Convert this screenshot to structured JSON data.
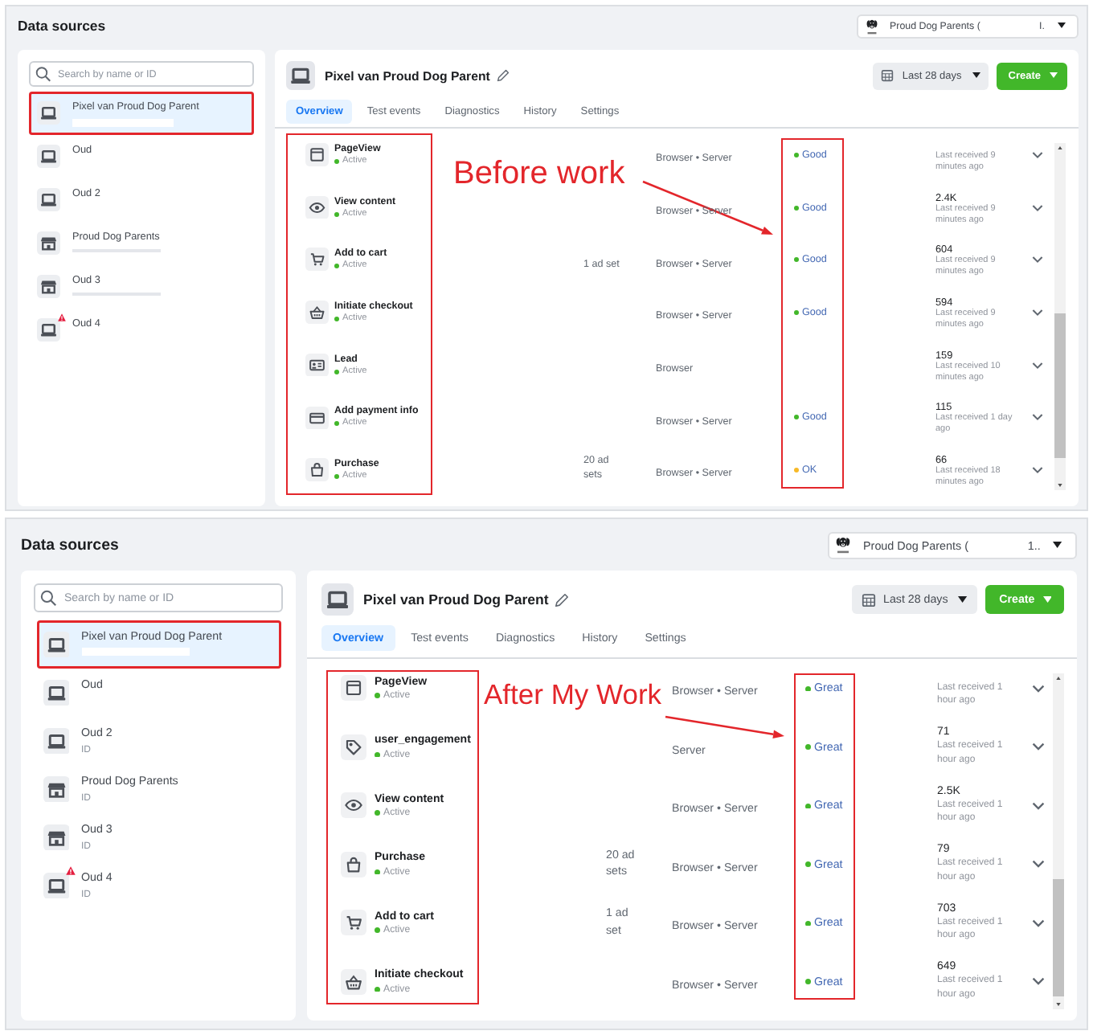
{
  "screens": [
    {
      "title": "Data sources",
      "account": {
        "name": "Proud Dog Parents (",
        "suffix": "I."
      },
      "search": {
        "placeholder": "Search by name or ID"
      },
      "sources": [
        {
          "kind": "pixel",
          "name": "Pixel van Proud Dog Parent",
          "selected": true,
          "outlined": true,
          "redacted": true,
          "warning": false
        },
        {
          "kind": "pixel",
          "name": "Oud",
          "selected": false,
          "outlined": false,
          "redacted": false,
          "warning": false
        },
        {
          "kind": "pixel",
          "name": "Oud 2",
          "selected": false,
          "outlined": false,
          "redacted": false,
          "warning": false
        },
        {
          "kind": "store",
          "name": "Proud Dog Parents",
          "selected": false,
          "outlined": false,
          "redacted": true,
          "warning": false
        },
        {
          "kind": "store",
          "name": "Oud 3",
          "selected": false,
          "outlined": false,
          "redacted": true,
          "warning": false
        },
        {
          "kind": "pixel",
          "name": "Oud 4",
          "selected": false,
          "outlined": false,
          "redacted": false,
          "warning": true
        }
      ],
      "pixel": {
        "title": "Pixel van Proud Dog Parent",
        "date_range": "Last 28 days",
        "create": "Create"
      },
      "tabs": [
        {
          "label": "Overview",
          "selected": true
        },
        {
          "label": "Test events",
          "selected": false
        },
        {
          "label": "Diagnostics",
          "selected": false
        },
        {
          "label": "History",
          "selected": false
        },
        {
          "label": "Settings",
          "selected": false
        }
      ],
      "events": [
        {
          "kind": "pageview",
          "name": "PageView",
          "status": "Active",
          "integration": "Browser • Server",
          "quality": {
            "text": "Good",
            "color": "#42b72a"
          },
          "last_received": "Last received 9 minutes ago"
        },
        {
          "kind": "view",
          "name": "View content",
          "status": "Active",
          "integration": "Browser • Server",
          "quality": {
            "text": "Good",
            "color": "#42b72a"
          },
          "count": "2.4K",
          "last_received": "Last received 9 minutes ago"
        },
        {
          "kind": "cart",
          "name": "Add to cart",
          "status": "Active",
          "ad_sets": "1 ad set",
          "integration": "Browser • Server",
          "quality": {
            "text": "Good",
            "color": "#42b72a"
          },
          "count": "604",
          "last_received": "Last received 9 minutes ago"
        },
        {
          "kind": "checkout",
          "name": "Initiate checkout",
          "status": "Active",
          "integration": "Browser • Server",
          "quality": {
            "text": "Good",
            "color": "#42b72a"
          },
          "count": "594",
          "last_received": "Last received 9 minutes ago"
        },
        {
          "kind": "lead",
          "name": "Lead",
          "status": "Active",
          "integration": "Browser",
          "count": "159",
          "last_received": "Last received 10 minutes ago"
        },
        {
          "kind": "payment",
          "name": "Add payment info",
          "status": "Active",
          "integration": "Browser • Server",
          "quality": {
            "text": "Good",
            "color": "#42b72a"
          },
          "count": "115",
          "last_received": "Last received 1 day ago"
        },
        {
          "kind": "purchase",
          "name": "Purchase",
          "status": "Active",
          "ad_sets": "20 ad sets",
          "integration": "Browser • Server",
          "quality": {
            "text": "OK",
            "color": "#f7b928"
          },
          "count": "66",
          "last_received": "Last received 18 minutes ago"
        }
      ],
      "annotation": {
        "note": "Before work"
      }
    },
    {
      "title": "Data sources",
      "account": {
        "name": "Proud Dog Parents (",
        "suffix": "1.."
      },
      "search": {
        "placeholder": "Search by name or ID"
      },
      "sources": [
        {
          "kind": "pixel",
          "name": "Pixel van Proud Dog Parent",
          "selected": true,
          "outlined": true,
          "redacted": true,
          "warning": false
        },
        {
          "kind": "pixel",
          "name": "Oud",
          "selected": false,
          "outlined": false,
          "redacted": false,
          "warning": false
        },
        {
          "kind": "pixel",
          "name": "Oud 2",
          "subtitle": "ID",
          "selected": false,
          "outlined": false,
          "redacted": false,
          "warning": false
        },
        {
          "kind": "store",
          "name": "Proud Dog Parents",
          "subtitle": "ID",
          "selected": false,
          "outlined": false,
          "redacted": false,
          "warning": false
        },
        {
          "kind": "store",
          "name": "Oud 3",
          "subtitle": "ID",
          "selected": false,
          "outlined": false,
          "redacted": false,
          "warning": false
        },
        {
          "kind": "pixel",
          "name": "Oud 4",
          "subtitle": "ID",
          "selected": false,
          "outlined": false,
          "redacted": false,
          "warning": true
        }
      ],
      "pixel": {
        "title": "Pixel van Proud Dog Parent",
        "date_range": "Last 28 days",
        "create": "Create"
      },
      "tabs": [
        {
          "label": "Overview",
          "selected": true
        },
        {
          "label": "Test events",
          "selected": false
        },
        {
          "label": "Diagnostics",
          "selected": false
        },
        {
          "label": "History",
          "selected": false
        },
        {
          "label": "Settings",
          "selected": false
        }
      ],
      "events": [
        {
          "kind": "pageview",
          "name": "PageView",
          "status": "Active",
          "integration": "Browser • Server",
          "quality": {
            "text": "Great",
            "color": "#42b72a"
          },
          "last_received": "Last received 1 hour ago"
        },
        {
          "kind": "engagement",
          "name": "user_engagement",
          "status": "Active",
          "integration": "Server",
          "quality": {
            "text": "Great",
            "color": "#42b72a"
          },
          "count": "71",
          "last_received": "Last received 1 hour ago"
        },
        {
          "kind": "view",
          "name": "View content",
          "status": "Active",
          "integration": "Browser • Server",
          "quality": {
            "text": "Great",
            "color": "#42b72a"
          },
          "count": "2.5K",
          "last_received": "Last received 1 hour ago"
        },
        {
          "kind": "purchase",
          "name": "Purchase",
          "status": "Active",
          "ad_sets": "20 ad sets",
          "integration": "Browser • Server",
          "quality": {
            "text": "Great",
            "color": "#42b72a"
          },
          "count": "79",
          "last_received": "Last received 1 hour ago"
        },
        {
          "kind": "cart",
          "name": "Add to cart",
          "status": "Active",
          "ad_sets": "1 ad set",
          "integration": "Browser • Server",
          "quality": {
            "text": "Great",
            "color": "#42b72a"
          },
          "count": "703",
          "last_received": "Last received 1 hour ago"
        },
        {
          "kind": "checkout",
          "name": "Initiate checkout",
          "status": "Active",
          "integration": "Browser • Server",
          "quality": {
            "text": "Great",
            "color": "#42b72a"
          },
          "count": "649",
          "last_received": "Last received 1 hour ago"
        }
      ],
      "annotation": {
        "note": "After My Work"
      }
    }
  ]
}
